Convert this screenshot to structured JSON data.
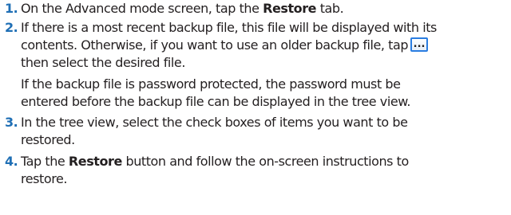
{
  "steps": [
    {
      "number": "1.",
      "lines": [
        {
          "pre": "On the Advanced mode screen, tap the ",
          "bold": "Restore",
          "post": " tab."
        }
      ]
    },
    {
      "number": "2.",
      "lines": [
        {
          "text": "If there is a most recent backup file, this file will be displayed with its"
        },
        {
          "text": "contents. Otherwise, if you want to use an older backup file, tap"
        },
        {
          "text": "then select the desired file."
        }
      ],
      "note_lines": [
        "If the backup file is password protected, the password must be",
        "entered before the backup file can be displayed in the tree view."
      ],
      "browse_button_glyph": "..."
    },
    {
      "number": "3.",
      "lines": [
        {
          "text": "In the tree view, select the check boxes of items you want to be"
        },
        {
          "text": "restored."
        }
      ]
    },
    {
      "number": "4.",
      "lines": [
        {
          "pre": "Tap the ",
          "bold": "Restore",
          "post": " button and follow the on-screen instructions to"
        },
        {
          "text": "restore."
        }
      ]
    }
  ],
  "colors": {
    "step_number": "#1f6fb5",
    "text": "#231f20",
    "button_border": "#2a7de1"
  }
}
